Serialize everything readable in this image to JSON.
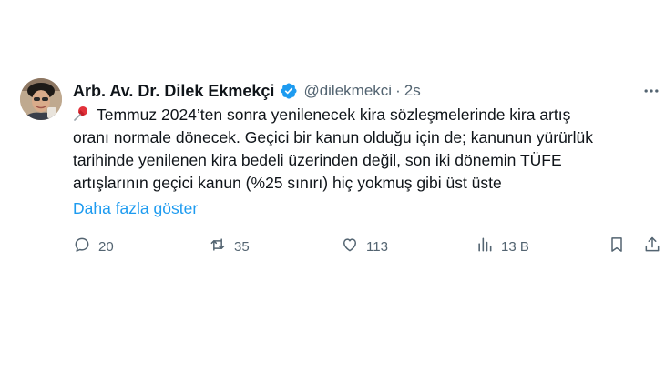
{
  "author": {
    "name": "Arb. Av. Dr. Dilek Ekmekçi",
    "handle": "@dilekmekci",
    "separator": "·",
    "time": "2s"
  },
  "body": {
    "line1": "Temmuz 2024’ten sonra yenilenecek kira sözleşmelerinde kira artış",
    "line2": "oranı normale dönecek. Geçici bir kanun olduğu için de; kanunun yürürlük",
    "line3": "tarihinde yenilenen kira bedeli üzerinden değil, son iki dönemin TÜFE",
    "line4": "artışlarının geçici kanun (%25 sınırı) hiç yokmuş gibi üst üste",
    "show_more": "Daha fazla göster"
  },
  "actions": {
    "replies": "20",
    "reposts": "35",
    "likes": "113",
    "views": "13 B"
  },
  "colors": {
    "text": "#0f1419",
    "secondary": "#536471",
    "link": "#1d9bf0",
    "verified": "#1d9bf0"
  }
}
